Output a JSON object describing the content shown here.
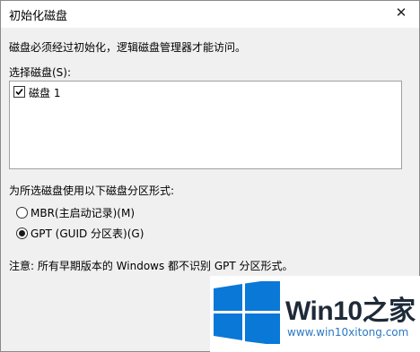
{
  "window": {
    "title": "初始化磁盘",
    "close_glyph": "✕"
  },
  "description": "磁盘必须经过初始化，逻辑磁盘管理器才能访问。",
  "select_label": "选择磁盘(S):",
  "disks": [
    {
      "label": "磁盘 1",
      "checked": true
    }
  ],
  "partition_label": "为所选磁盘使用以下磁盘分区形式:",
  "partition_options": [
    {
      "label": "MBR(主启动记录)(M)",
      "selected": false
    },
    {
      "label": "GPT (GUID 分区表)(G)",
      "selected": true
    }
  ],
  "note": "注意: 所有早期版本的 Windows 都不识别 GPT 分区形式。",
  "watermark": {
    "brand": "Win10之家",
    "url": "www.win10xitong.com",
    "logo_color": "#0a78d7"
  }
}
